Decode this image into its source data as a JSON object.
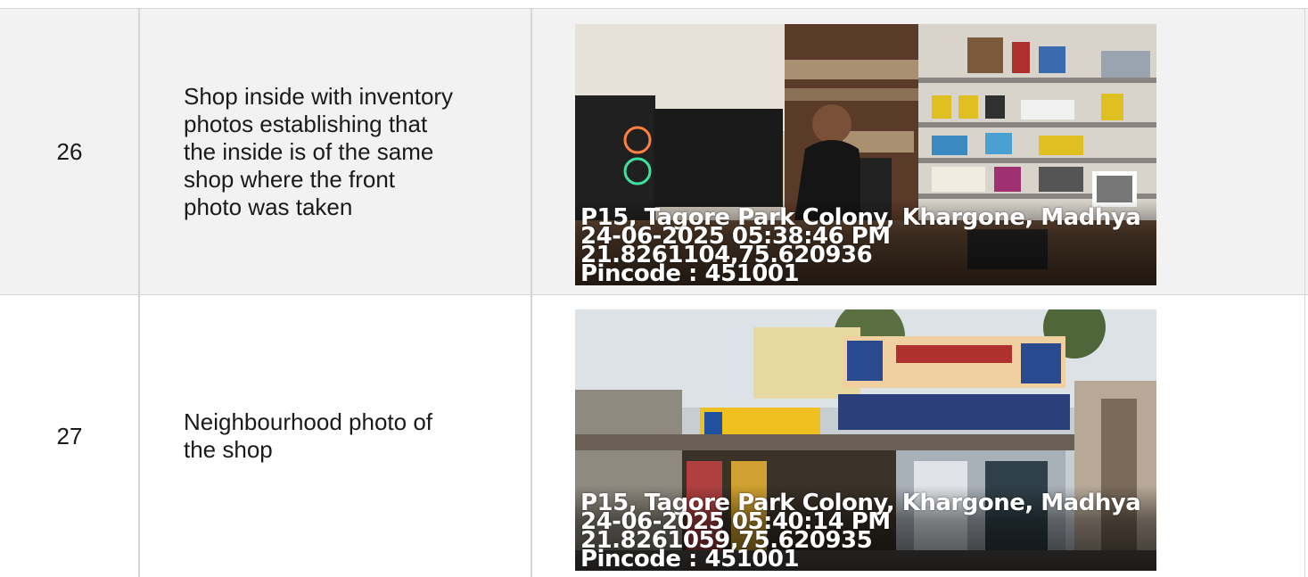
{
  "rows": [
    {
      "number": "26",
      "description": "Shop inside with inventory photos establishing that the inside is of the same shop where the front photo was taken",
      "description_lines": [
        "Shop inside with inventory",
        "photos establishing that",
        "the inside is of the same",
        "shop where the front",
        "photo was taken"
      ],
      "photo": {
        "subject": "shop-interior-with-shopkeeper",
        "overlay": {
          "address": "P15, Tagore Park Colony, Khargone, Madhya",
          "datetime": "24-06-2025 05:38:46 PM",
          "coords": "21.8261104,75.620936",
          "pincode": "Pincode : 451001"
        }
      }
    },
    {
      "number": "27",
      "description": "Neighbourhood photo of the shop",
      "description_lines": [
        "Neighbourhood photo of",
        "the shop"
      ],
      "photo": {
        "subject": "shop-street-front",
        "overlay": {
          "address": "P15, Tagore Park Colony, Khargone, Madhya",
          "datetime": "24-06-2025 05:40:14 PM",
          "coords": "21.8261059,75.620935",
          "pincode": "Pincode : 451001"
        }
      }
    }
  ],
  "colors": {
    "row_shaded": "#f2f2f2",
    "row_plain": "#ffffff",
    "border": "#d5d5d5",
    "text": "#1a1a1a",
    "overlay_text": "#ffffff"
  }
}
